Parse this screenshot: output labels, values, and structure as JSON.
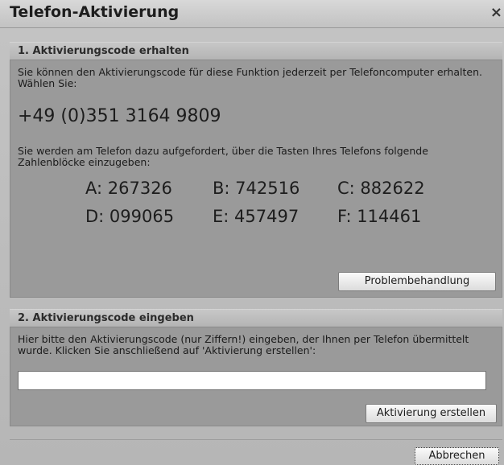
{
  "dialog": {
    "title": "Telefon-Aktivierung",
    "close_glyph": "×"
  },
  "section1": {
    "header": "1. Aktivierungscode erhalten",
    "intro": "Sie können den Aktivierungscode für diese Funktion jederzeit per Telefoncomputer erhalten. Wählen Sie:",
    "phone_number": "+49 (0)351 3164 9809",
    "instruction": "Sie werden am Telefon dazu aufgefordert, über die Tasten Ihres Telefons folgende Zahlenblöcke einzugeben:",
    "codes": [
      {
        "text": "A: 267326"
      },
      {
        "text": "B: 742516"
      },
      {
        "text": "C: 882622"
      },
      {
        "text": "D: 099065"
      },
      {
        "text": "E: 457497"
      },
      {
        "text": "F: 114461"
      }
    ],
    "troubleshoot_label": "Problembehandlung"
  },
  "section2": {
    "header": "2. Aktivierungscode eingeben",
    "instruction": "Hier bitte den Aktivierungscode (nur Ziffern!) eingeben, der Ihnen per Telefon übermittelt wurde. Klicken Sie anschließend auf 'Aktivierung erstellen':",
    "input_value": "",
    "create_label": "Aktivierung erstellen"
  },
  "footer": {
    "cancel_label": "Abbrechen"
  }
}
